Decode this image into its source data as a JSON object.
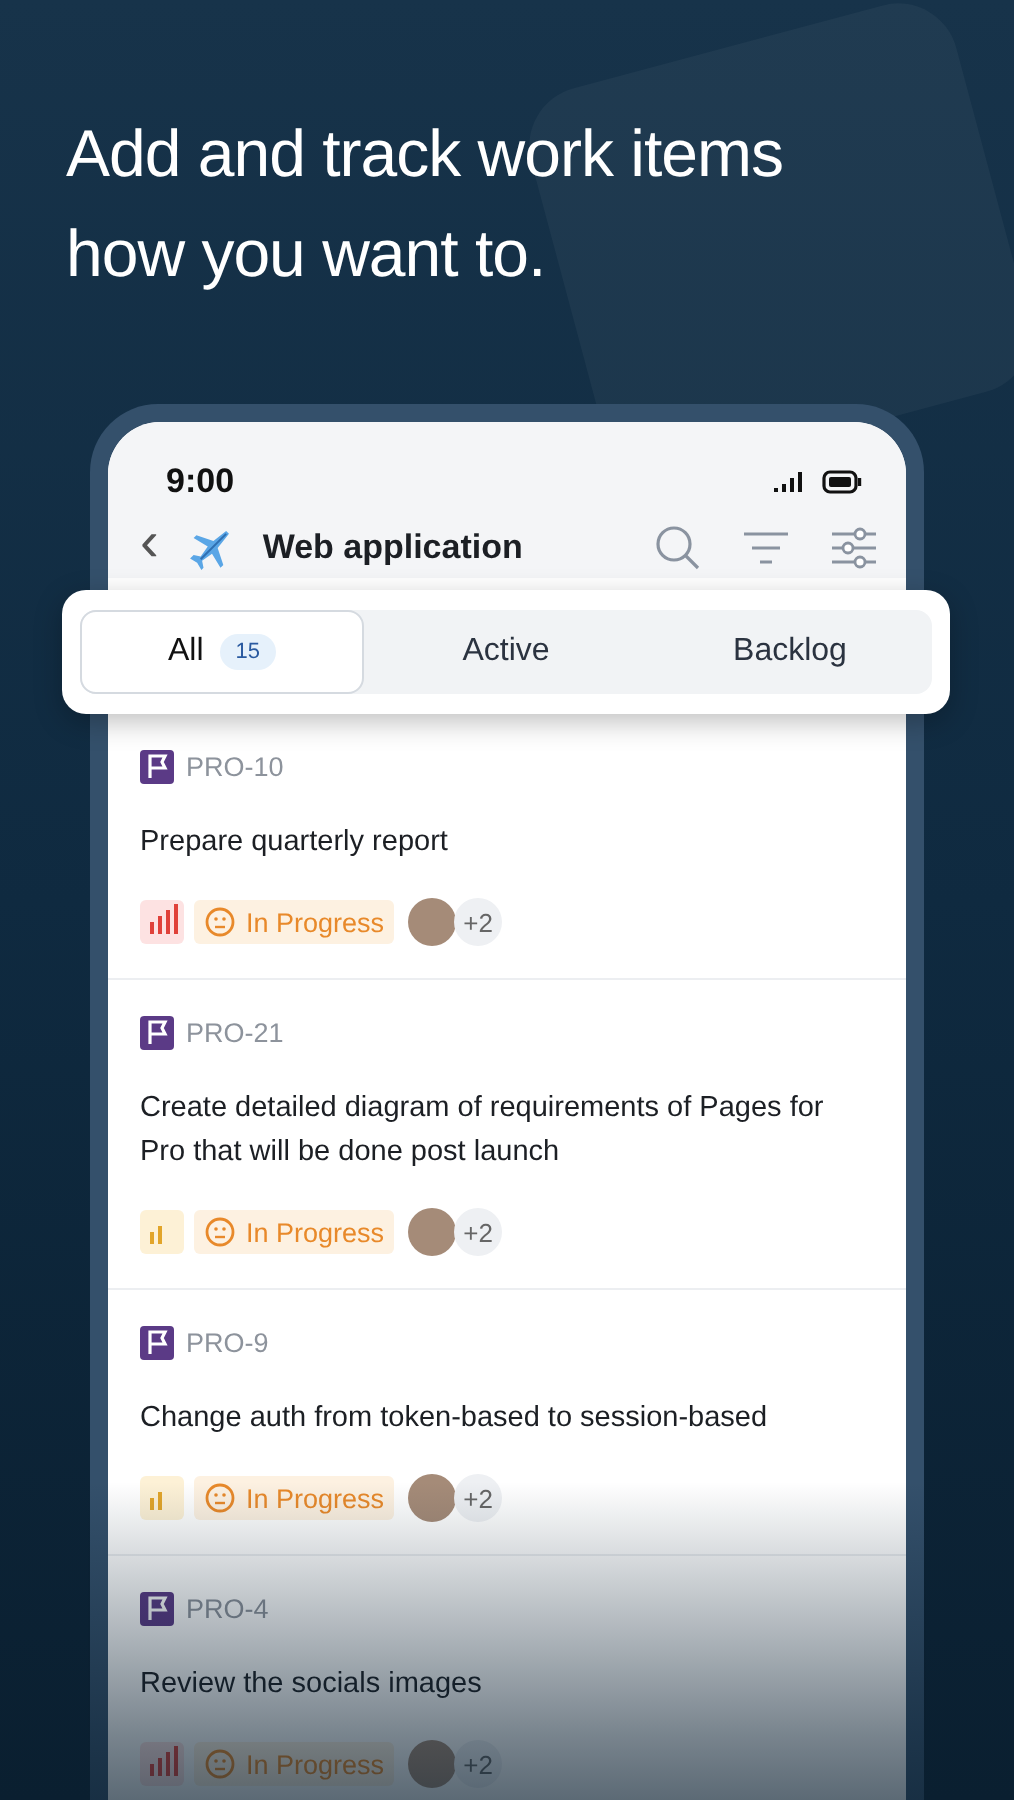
{
  "headline": "Add and track work items how you want to.",
  "status_bar": {
    "time": "9:00"
  },
  "header": {
    "back": "‹",
    "title": "Web application"
  },
  "tabs": [
    {
      "label": "All",
      "count": "15",
      "selected": true
    },
    {
      "label": "Active",
      "selected": false
    },
    {
      "label": "Backlog",
      "selected": false
    }
  ],
  "items": [
    {
      "id": "PRO-10",
      "title": "Prepare quarterly report",
      "kind": "high",
      "status": "In Progress",
      "extra": "+2"
    },
    {
      "id": "PRO-21",
      "title": "Create detailed diagram of requirements of Pages for Pro that will be done post launch",
      "kind": "medium",
      "status": "In Progress",
      "extra": "+2"
    },
    {
      "id": "PRO-9",
      "title": "Change auth from token-based to session-based",
      "kind": "medium",
      "status": "In Progress",
      "extra": "+2"
    },
    {
      "id": "PRO-4",
      "title": "Review the socials images",
      "kind": "high",
      "status": "In Progress",
      "extra": "+2"
    }
  ]
}
